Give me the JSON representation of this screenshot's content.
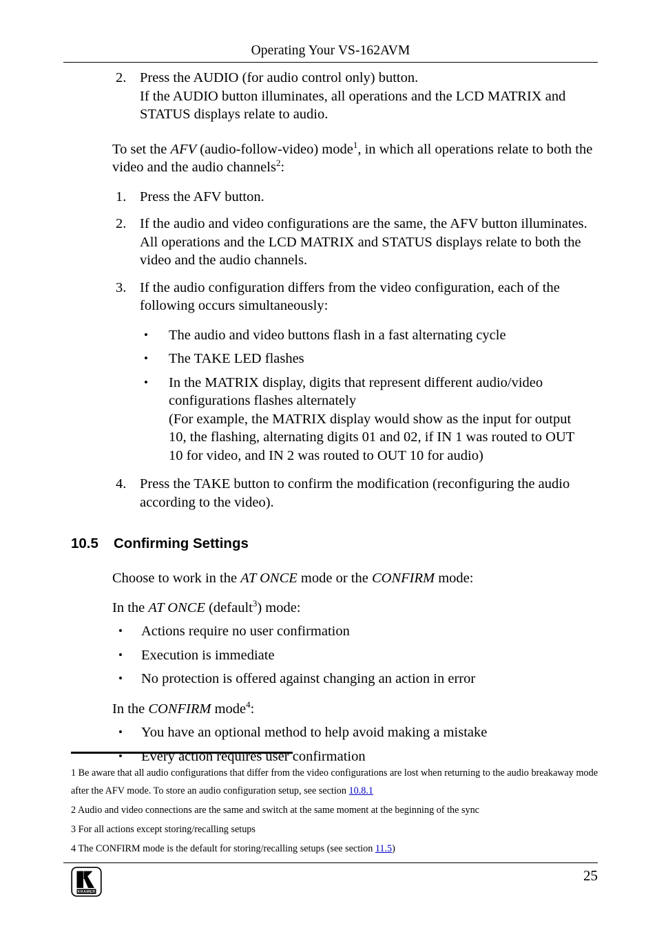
{
  "header": {
    "title": "Operating Your VS-162AVM"
  },
  "body": {
    "step_audio": {
      "number": "2.",
      "line1": "Press the AUDIO (for audio control only) button.",
      "line2": "If the AUDIO button illuminates, all operations and the LCD MATRIX and STATUS displays relate to audio."
    },
    "afv_intro": {
      "part1": "To set the ",
      "italic1": "AFV",
      "part2": " (audio-follow-video) mode",
      "sup1": "1",
      "part3": ", in which all operations relate to both the video and the audio channels",
      "sup2": "2",
      "part4": ":"
    },
    "afv_steps": [
      {
        "number": "1.",
        "text": "Press the AFV button."
      },
      {
        "number": "2.",
        "text": "If the audio and video configurations are the same, the AFV button illuminates. All operations and the LCD MATRIX and STATUS displays relate to both the video and the audio channels."
      },
      {
        "number": "3.",
        "text": "If the audio configuration differs from the video configuration, each of the following occurs simultaneously:"
      }
    ],
    "afv_sub_bullets": [
      "The audio and video buttons flash in a fast alternating cycle",
      "The TAKE LED flashes",
      "In the MATRIX display, digits that represent different audio/video configurations flashes alternately\n(For example, the MATRIX display would show as the input for output 10, the flashing, alternating digits 01 and 02, if IN 1 was routed to OUT 10 for video, and IN 2 was routed to OUT 10 for audio)"
    ],
    "afv_step4": {
      "number": "4.",
      "text": "Press the TAKE button to confirm the modification (reconfiguring the audio according to the video)."
    },
    "section": {
      "number": "10.5",
      "title": "Confirming Settings"
    },
    "choose_para": {
      "part1": "Choose to work in the ",
      "italic1": "AT ONCE",
      "part2": " mode or the ",
      "italic2": "CONFIRM",
      "part3": " mode:"
    },
    "at_once_intro": {
      "part1": "In the ",
      "italic1": "AT ONCE",
      "part2": " (default",
      "sup": "3",
      "part3": ") mode:"
    },
    "at_once_bullets": [
      "Actions require no user confirmation",
      "Execution is immediate",
      "No protection is offered against changing an action in error"
    ],
    "confirm_intro": {
      "part1": "In the ",
      "italic1": "CONFIRM",
      "part2": " mode",
      "sup": "4",
      "part3": ":"
    },
    "confirm_bullets": [
      "You have an optional method to help avoid making a mistake",
      "Every action requires user confirmation"
    ],
    "bullet_glyph": "•"
  },
  "footnotes": [
    {
      "marker": "1",
      "text_before": "1 Be aware that all audio configurations that differ from the video configurations are lost when returning to the audio breakaway mode after the AFV mode. To store an audio configuration setup, see section ",
      "link": "10.8.1",
      "text_after": ""
    },
    {
      "marker": "2",
      "text_before": "2 Audio and video connections are the same and switch at the same moment at the beginning of the sync",
      "link": "",
      "text_after": ""
    },
    {
      "marker": "3",
      "text_before": "3 For all actions except storing/recalling setups",
      "link": "",
      "text_after": ""
    },
    {
      "marker": "4",
      "text_before": "4 The CONFIRM mode is the default for storing/recalling setups (see section ",
      "link": "11.5",
      "text_after": ")"
    }
  ],
  "footer": {
    "page_number": "25",
    "logo_text": "KRAMER",
    "logo_letter": "K"
  },
  "colors": {
    "text": "#000000",
    "link": "#0000CC",
    "rule": "#000000",
    "background": "#FFFFFF"
  }
}
